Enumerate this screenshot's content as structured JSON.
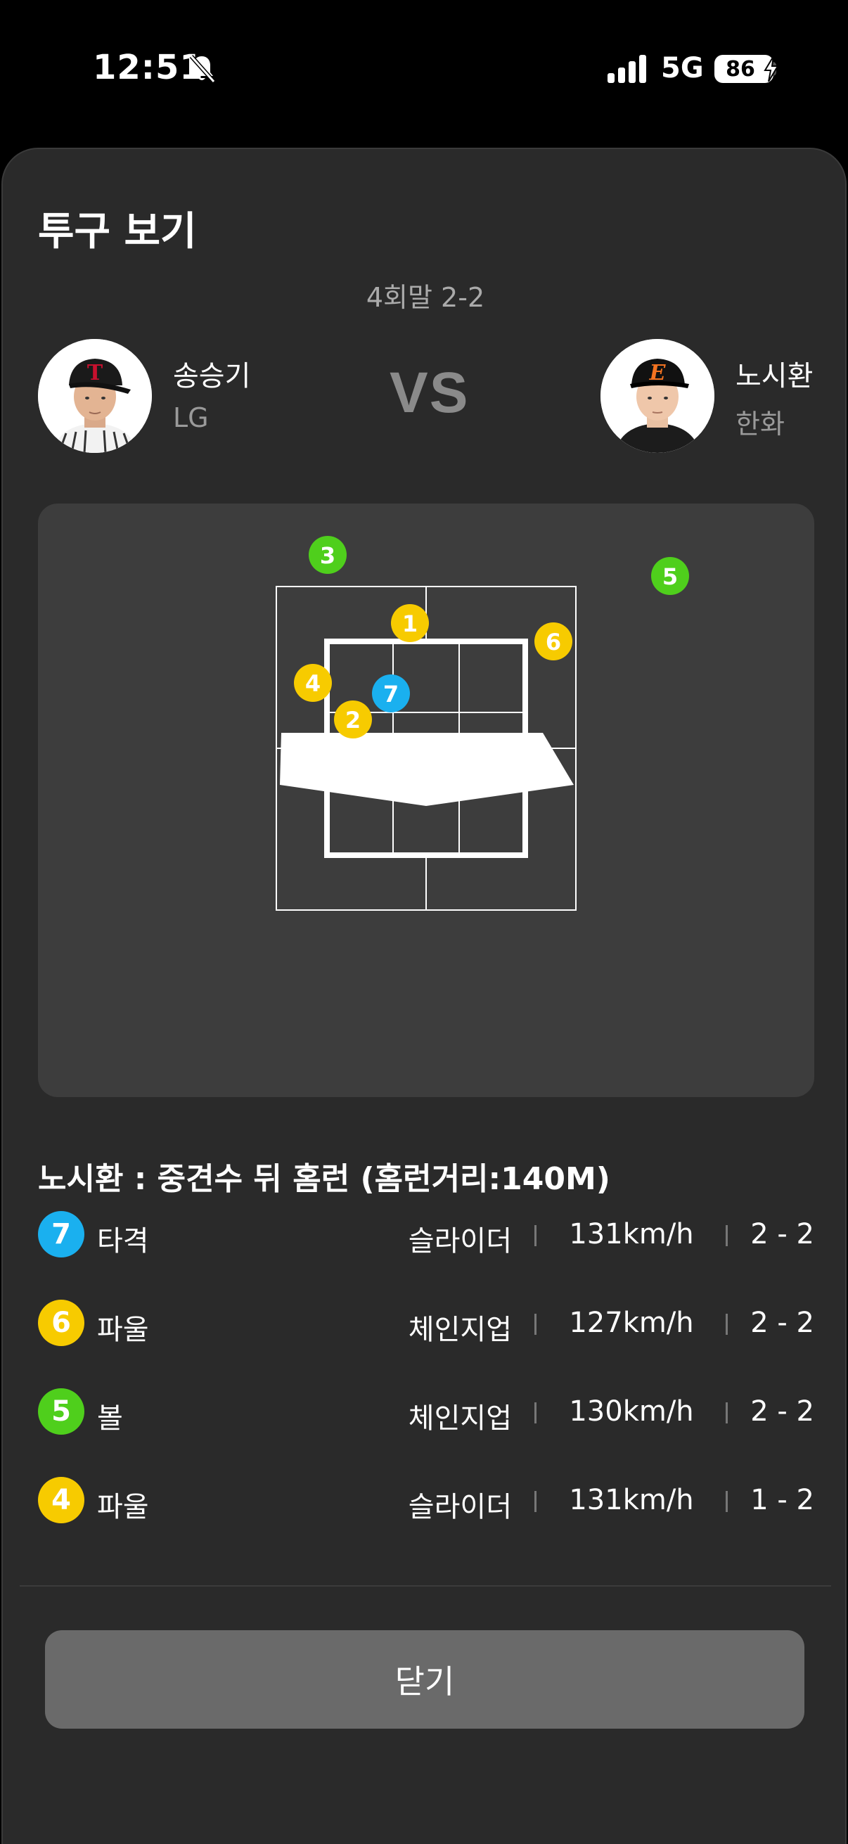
{
  "status_bar": {
    "time": "12:51",
    "network": "5G",
    "battery": "86",
    "icons": [
      "bell-slash-icon",
      "signal-icon",
      "charging-bolt-icon"
    ]
  },
  "sheet": {
    "title": "투구 보기",
    "inning": "4회말 2-2",
    "vs": "VS"
  },
  "pitcher": {
    "name": "송승기",
    "team": "LG",
    "cap_letter": "T",
    "cap_color": "#1a1a1a",
    "letter_color": "#c8102e"
  },
  "batter": {
    "name": "노시환",
    "team": "한화",
    "cap_letter": "E",
    "cap_color": "#111111",
    "letter_color": "#f37321"
  },
  "pitch_colors": {
    "hit": "#1ab0ef",
    "foul": "#f7cb00",
    "ball": "#4fcf1c",
    "strike": "#f7cb00"
  },
  "pitch_markers": [
    {
      "num": "1",
      "color": "#f7cb00"
    },
    {
      "num": "2",
      "color": "#f7cb00"
    },
    {
      "num": "3",
      "color": "#4fcf1c"
    },
    {
      "num": "4",
      "color": "#f7cb00"
    },
    {
      "num": "5",
      "color": "#4fcf1c"
    },
    {
      "num": "6",
      "color": "#f7cb00"
    },
    {
      "num": "7",
      "color": "#1ab0ef"
    }
  ],
  "result": "노시환 : 중견수 뒤 홈런 (홈런거리:140M)",
  "pitches": [
    {
      "num": "7",
      "color": "#1ab0ef",
      "result": "타격",
      "type": "슬라이더",
      "speed": "131km/h",
      "count": "2 - 2"
    },
    {
      "num": "6",
      "color": "#f7cb00",
      "result": "파울",
      "type": "체인지업",
      "speed": "127km/h",
      "count": "2 - 2"
    },
    {
      "num": "5",
      "color": "#4fcf1c",
      "result": "볼",
      "type": "체인지업",
      "speed": "130km/h",
      "count": "2 - 2"
    },
    {
      "num": "4",
      "color": "#f7cb00",
      "result": "파울",
      "type": "슬라이더",
      "speed": "131km/h",
      "count": "1 - 2"
    }
  ],
  "close_label": "닫기"
}
